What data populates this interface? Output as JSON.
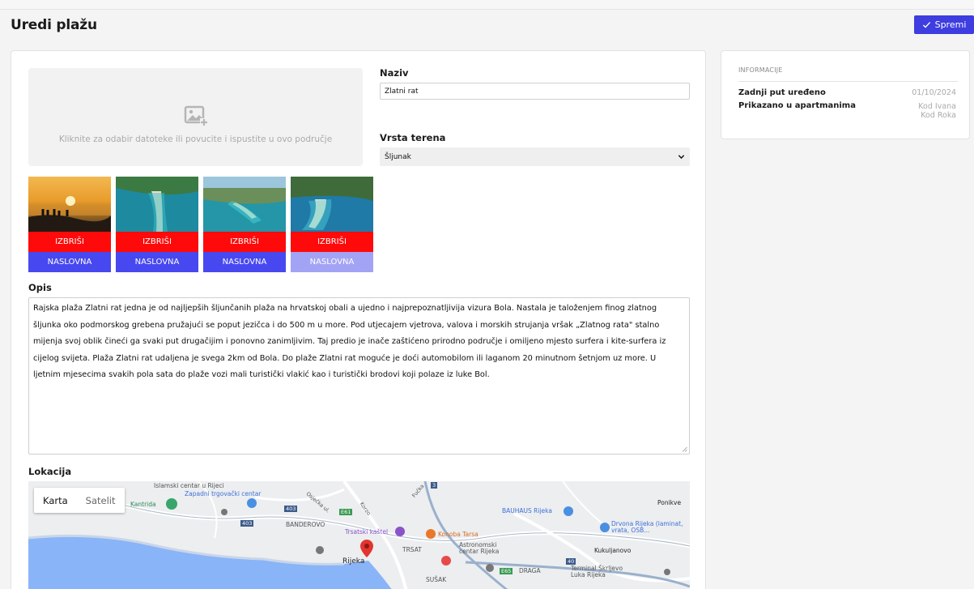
{
  "header": {
    "title": "Uredi plažu",
    "save_label": "Spremi"
  },
  "form": {
    "dropzone_text": "Kliknite za odabir datoteke ili povucite i ispustite u ovo područje",
    "name_label": "Naziv",
    "name_value": "Zlatni rat",
    "terrain_label": "Vrsta terena",
    "terrain_value": "Šljunak",
    "images": [
      {
        "delete_label": "IZBRIŠI",
        "cover_label": "NASLOVNA",
        "is_cover": false
      },
      {
        "delete_label": "IZBRIŠI",
        "cover_label": "NASLOVNA",
        "is_cover": false
      },
      {
        "delete_label": "IZBRIŠI",
        "cover_label": "NASLOVNA",
        "is_cover": false
      },
      {
        "delete_label": "IZBRIŠI",
        "cover_label": "NASLOVNA",
        "is_cover": true
      }
    ],
    "description_label": "Opis",
    "description_value": "Rajska plaža Zlatni rat jedna je od najljepših šljunčanih plaža na hrvatskoj obali a ujedno i najprepoznatljivija vizura Bola. Nastala je taloženjem finog zlatnog šljunka oko podmorskog grebena pružajući se poput jezičca i do 500 m u more. Pod utjecajem vjetrova, valova i morskih strujanja vršak „Zlatnog rata\" stalno mijenja svoj oblik čineći ga svaki put drugačijim i ponovno zanimljivim. Taj predio je inače zaštićeno prirodno područje i omiljeno mjesto surfera i kite-surfera iz cijelog svijeta. Plaža Zlatni rat udaljena je svega 2km od Bola. Do plaže Zlatni rat moguće je doći automobilom ili laganom 20 minutnom šetnjom uz more. U ljetnim mjesecima svakih pola sata do plaže vozi mali turistički vlakić kao i turistički brodovi koji polaze iz luke Bol.",
    "location_label": "Lokacija"
  },
  "map": {
    "map_tab": "Karta",
    "satellite_tab": "Satelit",
    "labels": {
      "islamski": "Islamski centar u Rijeci",
      "zapadni": "Zapadni trgovački centar",
      "kantrida": "Kantrida",
      "banderovo": "BANDEROVO",
      "trsatski": "Trsatski kaštel",
      "konoba": "Konoba Tarsa",
      "trsat": "TRSAT",
      "astronomski": "Astronomski centar Rijeka",
      "rijeka": "Rijeka",
      "susak": "SUŠAK",
      "draga": "DRAGA",
      "terminal": "Terminal Škrljevo Luka Rijeka",
      "kukuljanovo": "Kukuljanovo",
      "bauhaus": "BAUHAUS Rijeka",
      "drvona": "Drvona Rijeka (laminat, vrata, OSB...",
      "ponikve": "Ponikve",
      "r403a": "403",
      "r403b": "403",
      "e61": "E61",
      "e65": "E65",
      "r40": "40",
      "r3": "3",
      "ulica1": "Osječka ul.",
      "ulica2": "Korzo",
      "ulica3": "Fućka"
    }
  },
  "info": {
    "title": "INFORMACIJE",
    "last_edited_label": "Zadnji put uređeno",
    "last_edited_value": "01/10/2024",
    "shown_in_label": "Prikazano u apartmanima",
    "shown_in_values": [
      "Kod Ivana",
      "Kod Roka"
    ]
  },
  "colors": {
    "primary": "#3d3de0",
    "delete": "#ff0a0a",
    "cover": "#4848f0",
    "cover_active": "#a3a3f6"
  }
}
